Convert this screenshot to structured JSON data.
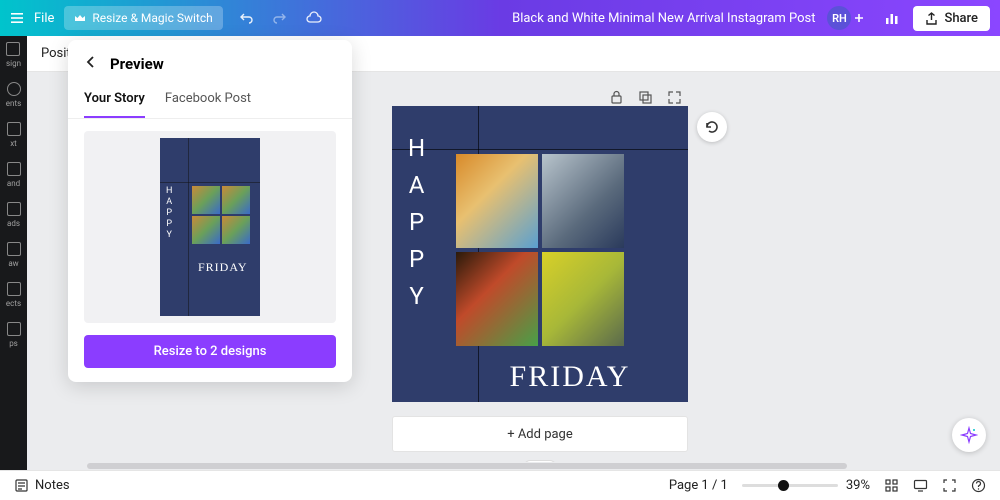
{
  "topbar": {
    "file": "File",
    "resize_switch": "Resize & Magic Switch",
    "title": "Black and White Minimal New Arrival Instagram Post",
    "avatar": "RH",
    "share": "Share"
  },
  "rail": {
    "items": [
      "sign",
      "ents",
      "xt",
      "and",
      "ads",
      "aw",
      "ects",
      "ps"
    ]
  },
  "sec_toolbar": {
    "position": "Positio"
  },
  "popover": {
    "title": "Preview",
    "tabs": {
      "your_story": "Your Story",
      "facebook_post": "Facebook Post"
    },
    "thumb": {
      "happy": [
        "H",
        "A",
        "P",
        "P",
        "Y"
      ],
      "friday": "FRIDAY"
    },
    "resize_btn": "Resize to 2 designs"
  },
  "artboard": {
    "happy": [
      "H",
      "A",
      "P",
      "P",
      "Y"
    ],
    "friday": "FRIDAY"
  },
  "addpage": "+ Add page",
  "bottombar": {
    "notes": "Notes",
    "page": "Page 1 / 1",
    "zoom": "39%"
  }
}
